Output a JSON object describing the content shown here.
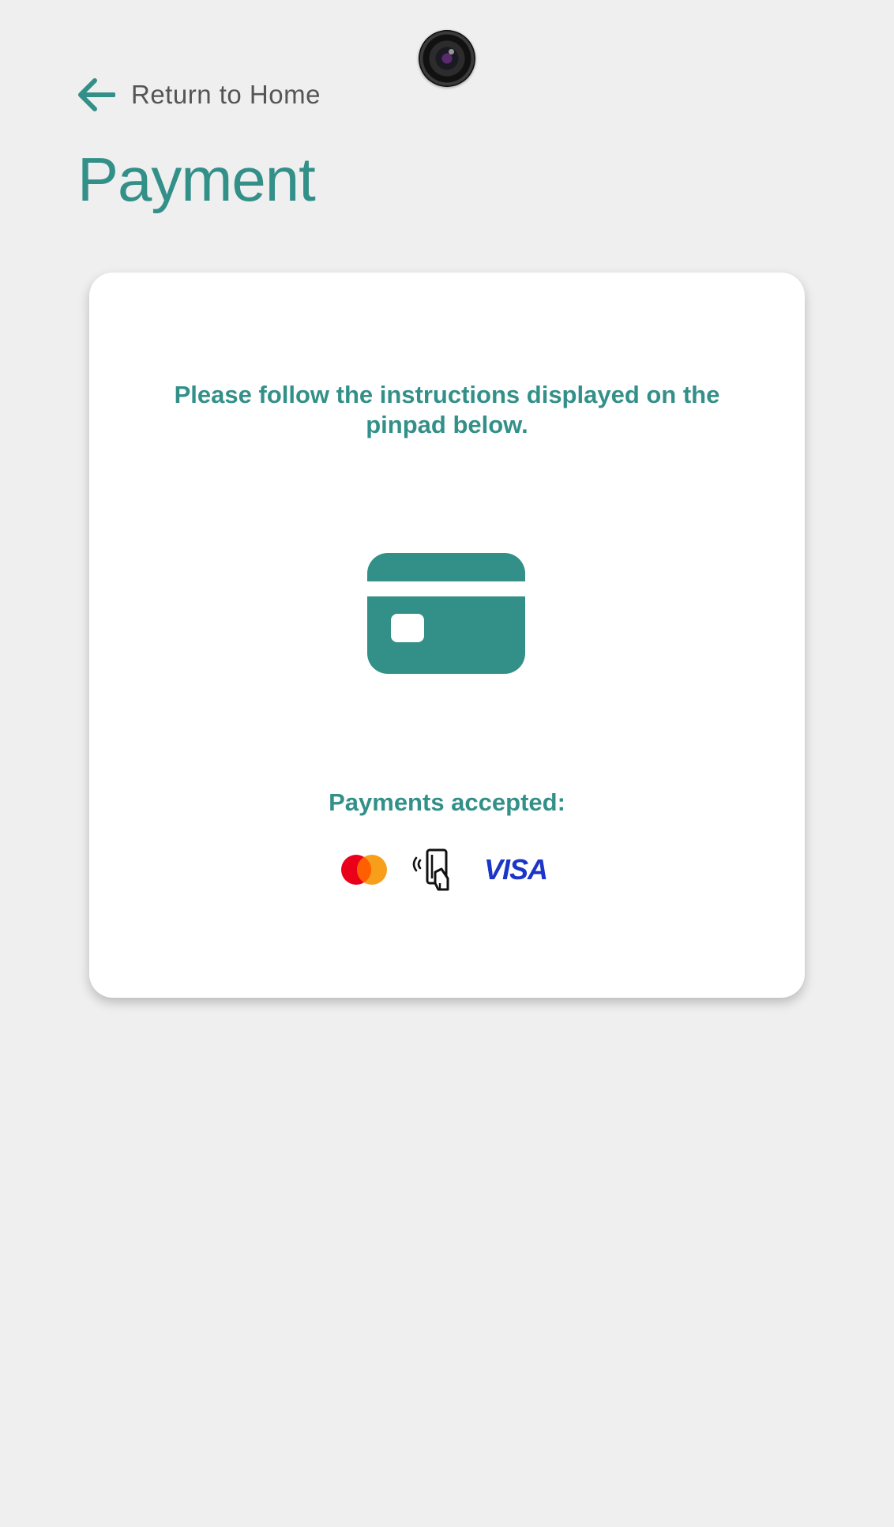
{
  "device": {
    "camera_icon": "camera-lens-icon"
  },
  "nav": {
    "back_icon": "arrow-left-icon",
    "back_label": "Return to Home"
  },
  "page": {
    "title": "Payment"
  },
  "payment_card": {
    "instructions": "Please follow the instructions  displayed on the pinpad below.",
    "card_icon": "credit-card-icon",
    "accepted_label": "Payments accepted:",
    "methods": [
      {
        "icon": "mastercard-logo"
      },
      {
        "icon": "contactless-card-icon"
      },
      {
        "icon": "visa-logo",
        "text": "VISA"
      }
    ]
  },
  "colors": {
    "accent": "#339089",
    "background": "#efefef",
    "card_background": "#ffffff",
    "muted_text": "#555555",
    "mastercard_red": "#eb001b",
    "mastercard_orange": "#f79e1b",
    "visa_blue": "#1a35c8"
  }
}
